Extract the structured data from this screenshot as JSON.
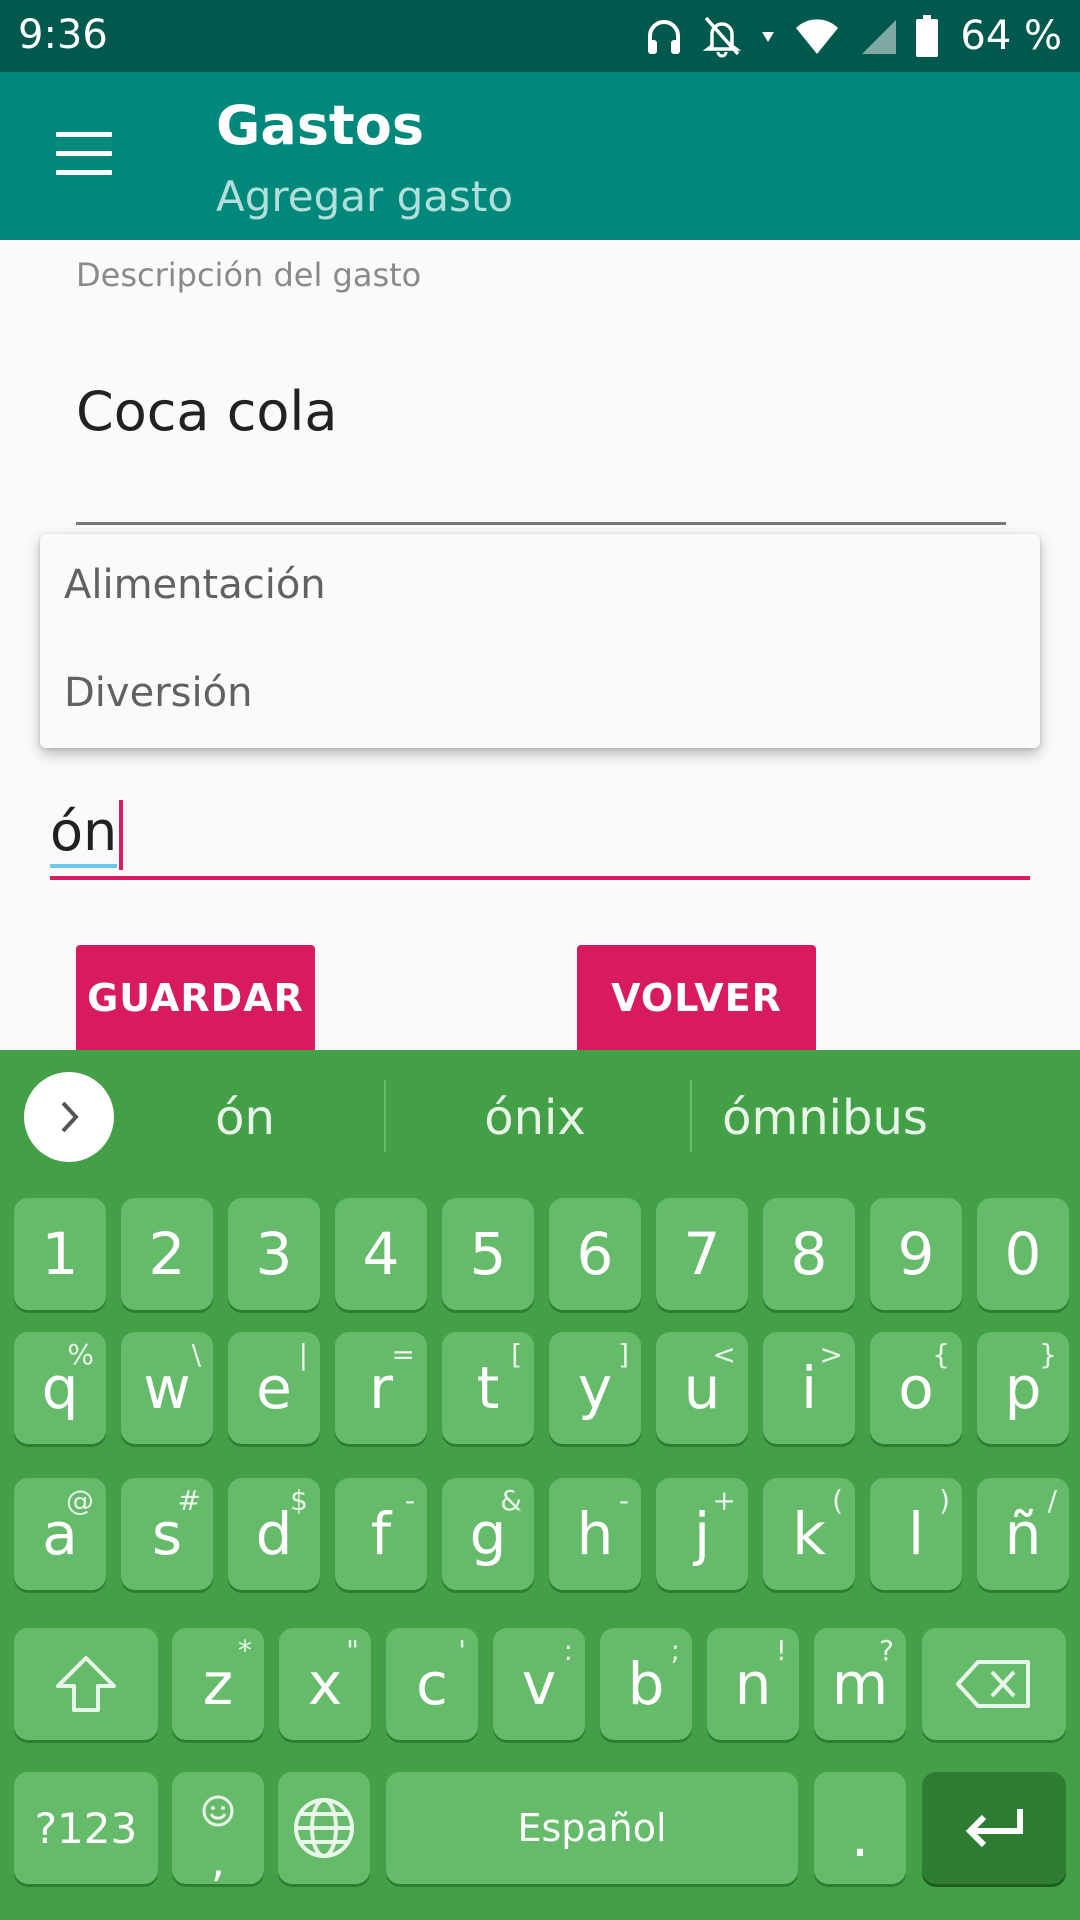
{
  "status_bar": {
    "time": "9:36",
    "battery": "64 %",
    "icons": [
      "headphones-icon",
      "notifications-off-icon",
      "data-arrow-icon",
      "wifi-icon",
      "signal-icon",
      "battery-icon"
    ]
  },
  "app_bar": {
    "title": "Gastos",
    "subtitle": "Agregar gasto",
    "menu_icon": "hamburger-menu-icon"
  },
  "form": {
    "description_label": "Descripción del gasto",
    "description_value": "Coca cola",
    "category_value": "ón",
    "dropdown_options": [
      "Alimentación",
      "Diversión"
    ],
    "save_label": "GUARDAR",
    "back_label": "VOLVER"
  },
  "keyboard": {
    "suggestions": [
      "ón",
      "ónix",
      "ómnibus"
    ],
    "rows": [
      [
        {
          "k": "1"
        },
        {
          "k": "2"
        },
        {
          "k": "3"
        },
        {
          "k": "4"
        },
        {
          "k": "5"
        },
        {
          "k": "6"
        },
        {
          "k": "7"
        },
        {
          "k": "8"
        },
        {
          "k": "9"
        },
        {
          "k": "0"
        }
      ],
      [
        {
          "k": "q",
          "s": "%"
        },
        {
          "k": "w",
          "s": "\\"
        },
        {
          "k": "e",
          "s": "|"
        },
        {
          "k": "r",
          "s": "="
        },
        {
          "k": "t",
          "s": "["
        },
        {
          "k": "y",
          "s": "]"
        },
        {
          "k": "u",
          "s": "<"
        },
        {
          "k": "i",
          "s": ">"
        },
        {
          "k": "o",
          "s": "{"
        },
        {
          "k": "p",
          "s": "}"
        }
      ],
      [
        {
          "k": "a",
          "s": "@"
        },
        {
          "k": "s",
          "s": "#"
        },
        {
          "k": "d",
          "s": "$"
        },
        {
          "k": "f",
          "s": "-"
        },
        {
          "k": "g",
          "s": "&"
        },
        {
          "k": "h",
          "s": "-"
        },
        {
          "k": "j",
          "s": "+"
        },
        {
          "k": "k",
          "s": "("
        },
        {
          "k": "l",
          "s": ")"
        },
        {
          "k": "ñ",
          "s": "/"
        }
      ],
      [
        {
          "k": "z",
          "s": "*"
        },
        {
          "k": "x",
          "s": "\""
        },
        {
          "k": "c",
          "s": "'"
        },
        {
          "k": "v",
          "s": ":"
        },
        {
          "k": "b",
          "s": ";"
        },
        {
          "k": "n",
          "s": "!"
        },
        {
          "k": "m",
          "s": "?"
        }
      ]
    ],
    "symbols_label": "?123",
    "comma_label": ",",
    "space_label": "Español",
    "period_label": "."
  },
  "colors": {
    "status_bar": "#00594c",
    "app_bar": "#00897b",
    "accent": "#d81b60",
    "keyboard_bg": "#43a047",
    "key_bg": "#66bb6a",
    "enter_key": "#2e7d32"
  }
}
